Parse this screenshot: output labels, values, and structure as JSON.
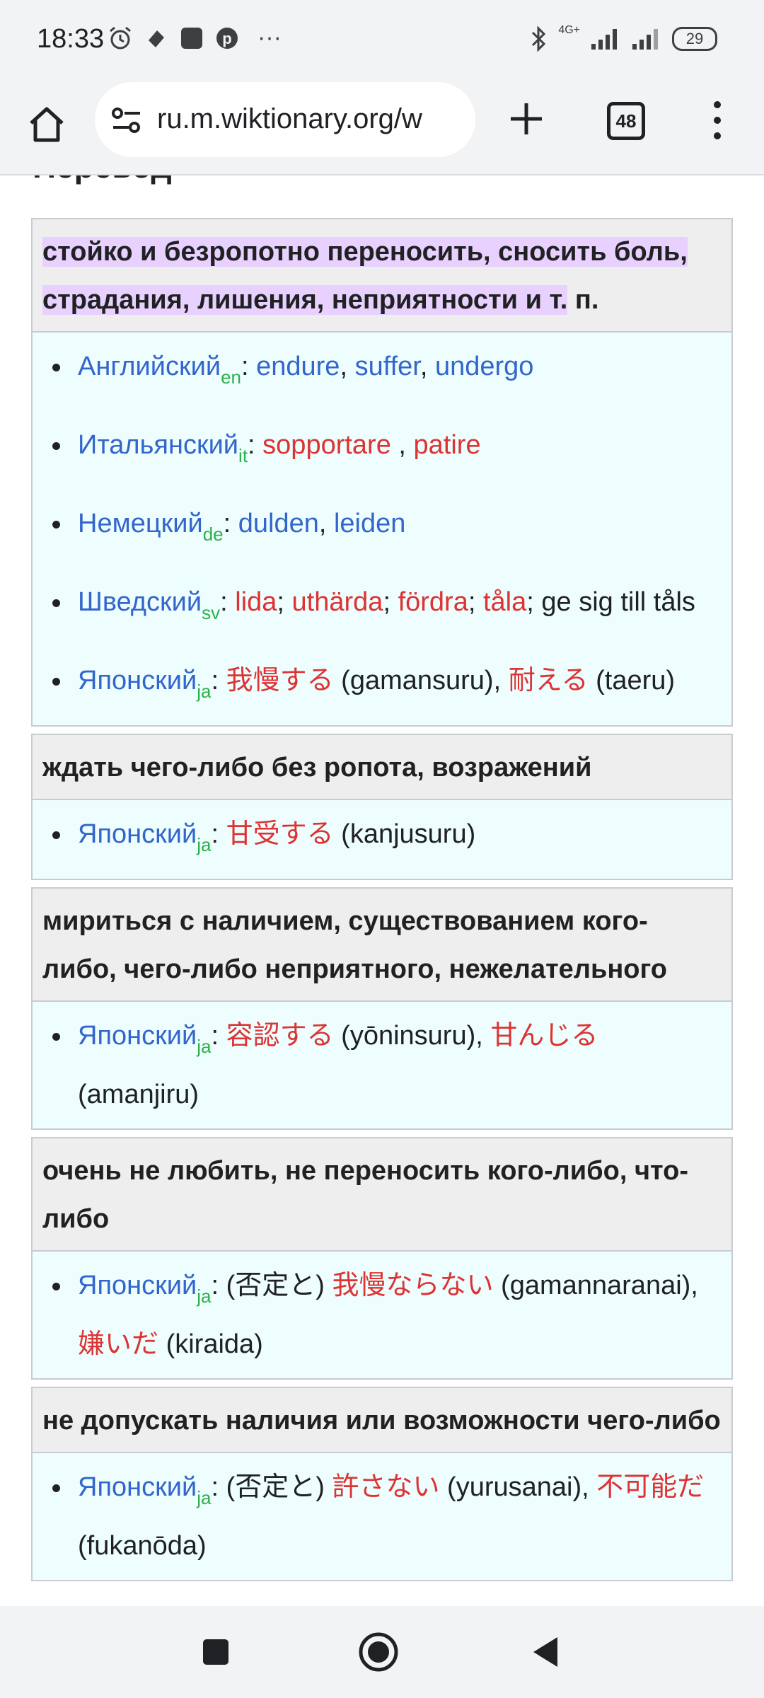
{
  "status_bar": {
    "time": "18:33",
    "network": "4G+",
    "battery": "29",
    "more": "···"
  },
  "browser": {
    "url": "ru.m.wiktionary.org/w",
    "tab_count": "48"
  },
  "page": {
    "heading": "Перевод",
    "sections": [
      {
        "sense_parts": [
          "стойко и безропотно переносить, сносить боль, страдания, лишения, неприятности и т.",
          " п."
        ],
        "items": [
          {
            "lang": "Английский",
            "code": "en",
            "sep": ": ",
            "words": [
              [
                "endure",
                "blue"
              ],
              [
                ", ",
                "plain"
              ],
              [
                "suffer",
                "blue"
              ],
              [
                ", ",
                "plain"
              ],
              [
                "undergo",
                "blue"
              ]
            ]
          },
          {
            "lang": "Итальянский",
            "code": "it",
            "sep": ": ",
            "words": [
              [
                "sopportare",
                "red"
              ],
              [
                " , ",
                "plain"
              ],
              [
                "patire",
                "red"
              ]
            ]
          },
          {
            "lang": "Немецкий",
            "code": "de",
            "sep": ": ",
            "words": [
              [
                "dulden",
                "blue"
              ],
              [
                ", ",
                "plain"
              ],
              [
                "leiden",
                "blue"
              ]
            ]
          },
          {
            "lang": "Шведский",
            "code": "sv",
            "sep": ": ",
            "words": [
              [
                "lida",
                "red"
              ],
              [
                "; ",
                "plain"
              ],
              [
                "uthärda",
                "red"
              ],
              [
                "; ",
                "plain"
              ],
              [
                "fördra",
                "red"
              ],
              [
                "; ",
                "plain"
              ],
              [
                "tåla",
                "red"
              ],
              [
                "; ge sig till tåls",
                "plain"
              ]
            ]
          },
          {
            "lang": "Японский",
            "code": "ja",
            "sep": ": ",
            "words": [
              [
                "我慢する",
                "red"
              ],
              [
                " (gamansuru), ",
                "plain"
              ],
              [
                "耐える",
                "red"
              ],
              [
                " (taeru)",
                "plain"
              ]
            ]
          }
        ]
      },
      {
        "sense_parts": [
          "ждать чего-либо без ропота, возражений"
        ],
        "items": [
          {
            "lang": "Японский",
            "code": "ja",
            "sep": ": ",
            "words": [
              [
                "甘受する",
                "red"
              ],
              [
                " (kanjusuru)",
                "plain"
              ]
            ]
          }
        ]
      },
      {
        "sense_parts": [
          "мириться с наличием, существованием кого-либо, чего-либо неприятного, нежелательного"
        ],
        "items": [
          {
            "lang": "Японский",
            "code": "ja",
            "sep": ": ",
            "words": [
              [
                "容認する",
                "red"
              ],
              [
                " (yōninsuru), ",
                "plain"
              ],
              [
                "甘んじる",
                "red"
              ],
              [
                " (amanjiru)",
                "plain"
              ]
            ]
          }
        ]
      },
      {
        "sense_parts": [
          "очень не любить, не переносить кого-либо, что-либо"
        ],
        "items": [
          {
            "lang": "Японский",
            "code": "ja",
            "sep": ": ",
            "words": [
              [
                "(否定と) ",
                "plain"
              ],
              [
                "我慢ならない",
                "red"
              ],
              [
                " (gamannaranai), ",
                "plain"
              ],
              [
                "嫌いだ",
                "red"
              ],
              [
                " (kiraida)",
                "plain"
              ]
            ]
          }
        ]
      },
      {
        "sense_parts": [
          "не допускать наличия или возможности чего-либо"
        ],
        "items": [
          {
            "lang": "Японский",
            "code": "ja",
            "sep": ": ",
            "words": [
              [
                "(否定と) ",
                "plain"
              ],
              [
                "許さない",
                "red"
              ],
              [
                " (yurusanai), ",
                "plain"
              ],
              [
                "不可能だ",
                "red"
              ],
              [
                " (fukanōda)",
                "plain"
              ]
            ]
          }
        ]
      }
    ]
  },
  "colors": {
    "link_blue": "#3366cc",
    "link_red": "#dd3333",
    "lang_code_green": "#2cb04a",
    "highlight": "#e8d0ff",
    "sense_bg": "#eeeeee",
    "trans_bg": "#eefefe"
  },
  "icons": {
    "status": [
      "alarm-icon",
      "app-icon",
      "app-square-icon",
      "pinterest-icon",
      "bluetooth-icon",
      "signal-icon",
      "battery-icon"
    ],
    "toolbar": [
      "home-icon",
      "site-settings-icon",
      "new-tab-icon",
      "tab-switcher-icon",
      "overflow-menu-icon"
    ],
    "nav": [
      "recents-icon",
      "home-circle-icon",
      "back-icon"
    ]
  }
}
